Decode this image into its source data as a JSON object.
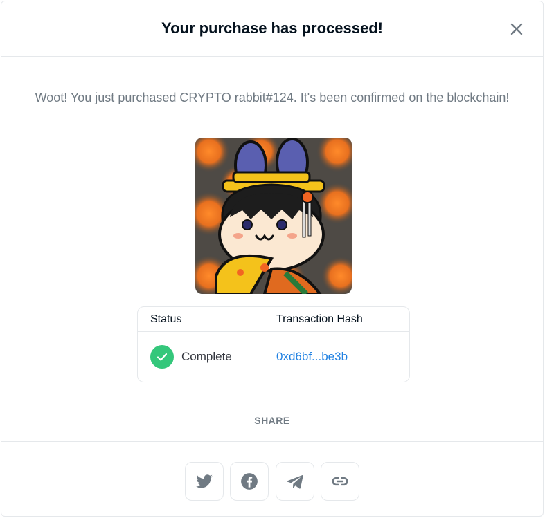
{
  "modal": {
    "title": "Your purchase has processed!",
    "close_icon": "close-icon",
    "message": "Woot! You just purchased CRYPTO rabbit#124. It's been confirmed on the blockchain!"
  },
  "nft": {
    "image_icon": "rabbit-nft-artwork"
  },
  "transaction": {
    "headers": {
      "status": "Status",
      "hash": "Transaction Hash"
    },
    "status": "Complete",
    "status_icon": "check-circle-icon",
    "status_color": "#34c77b",
    "hash": "0xd6bf...be3b",
    "link_color": "#2081e2"
  },
  "share": {
    "label": "SHARE",
    "buttons": [
      {
        "icon": "twitter-icon"
      },
      {
        "icon": "facebook-icon"
      },
      {
        "icon": "telegram-icon"
      },
      {
        "icon": "link-icon"
      }
    ]
  }
}
